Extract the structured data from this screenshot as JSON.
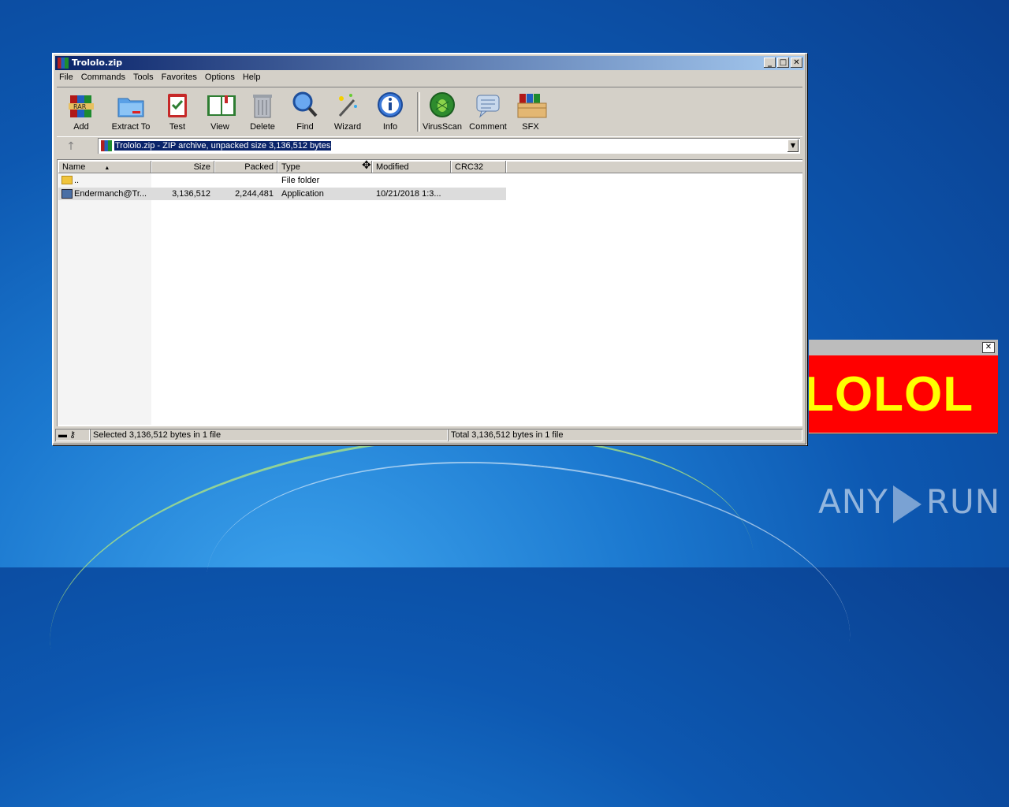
{
  "window": {
    "title": "Trololo.zip",
    "controls": {
      "minimize": "_",
      "maximize": "□",
      "close": "✕"
    }
  },
  "menu": [
    "File",
    "Commands",
    "Tools",
    "Favorites",
    "Options",
    "Help"
  ],
  "toolbar": [
    {
      "label": "Add",
      "icon": "add-archive-icon"
    },
    {
      "label": "Extract To",
      "icon": "extract-folder-icon"
    },
    {
      "label": "Test",
      "icon": "test-clipboard-icon"
    },
    {
      "label": "View",
      "icon": "view-book-icon"
    },
    {
      "label": "Delete",
      "icon": "trash-icon"
    },
    {
      "label": "Find",
      "icon": "magnifier-icon"
    },
    {
      "label": "Wizard",
      "icon": "wand-icon"
    },
    {
      "label": "Info",
      "icon": "info-icon"
    },
    {
      "label": "VirusScan",
      "icon": "virus-scan-icon"
    },
    {
      "label": "Comment",
      "icon": "comment-icon"
    },
    {
      "label": "SFX",
      "icon": "sfx-box-icon"
    }
  ],
  "address": {
    "text": "Trololo.zip - ZIP archive, unpacked size 3,136,512 bytes"
  },
  "columns": [
    "Name",
    "Size",
    "Packed",
    "Type",
    "Modified",
    "CRC32"
  ],
  "rows": [
    {
      "name": "..",
      "size": "",
      "packed": "",
      "type": "File folder",
      "modified": "",
      "crc": ""
    },
    {
      "name": "Endermanch@Tr...",
      "size": "3,136,512",
      "packed": "2,244,481",
      "type": "Application",
      "modified": "10/21/2018 1:3...",
      "crc": ""
    }
  ],
  "status": {
    "left": "Selected 3,136,512 bytes in 1 file",
    "right": "Total 3,136,512 bytes in 1 file"
  },
  "popup": {
    "text": "LOLOL",
    "close": "✕",
    "bg": "#ff0000",
    "fg": "#ffff00"
  },
  "watermark": {
    "left": "ANY",
    "right": "RUN"
  }
}
